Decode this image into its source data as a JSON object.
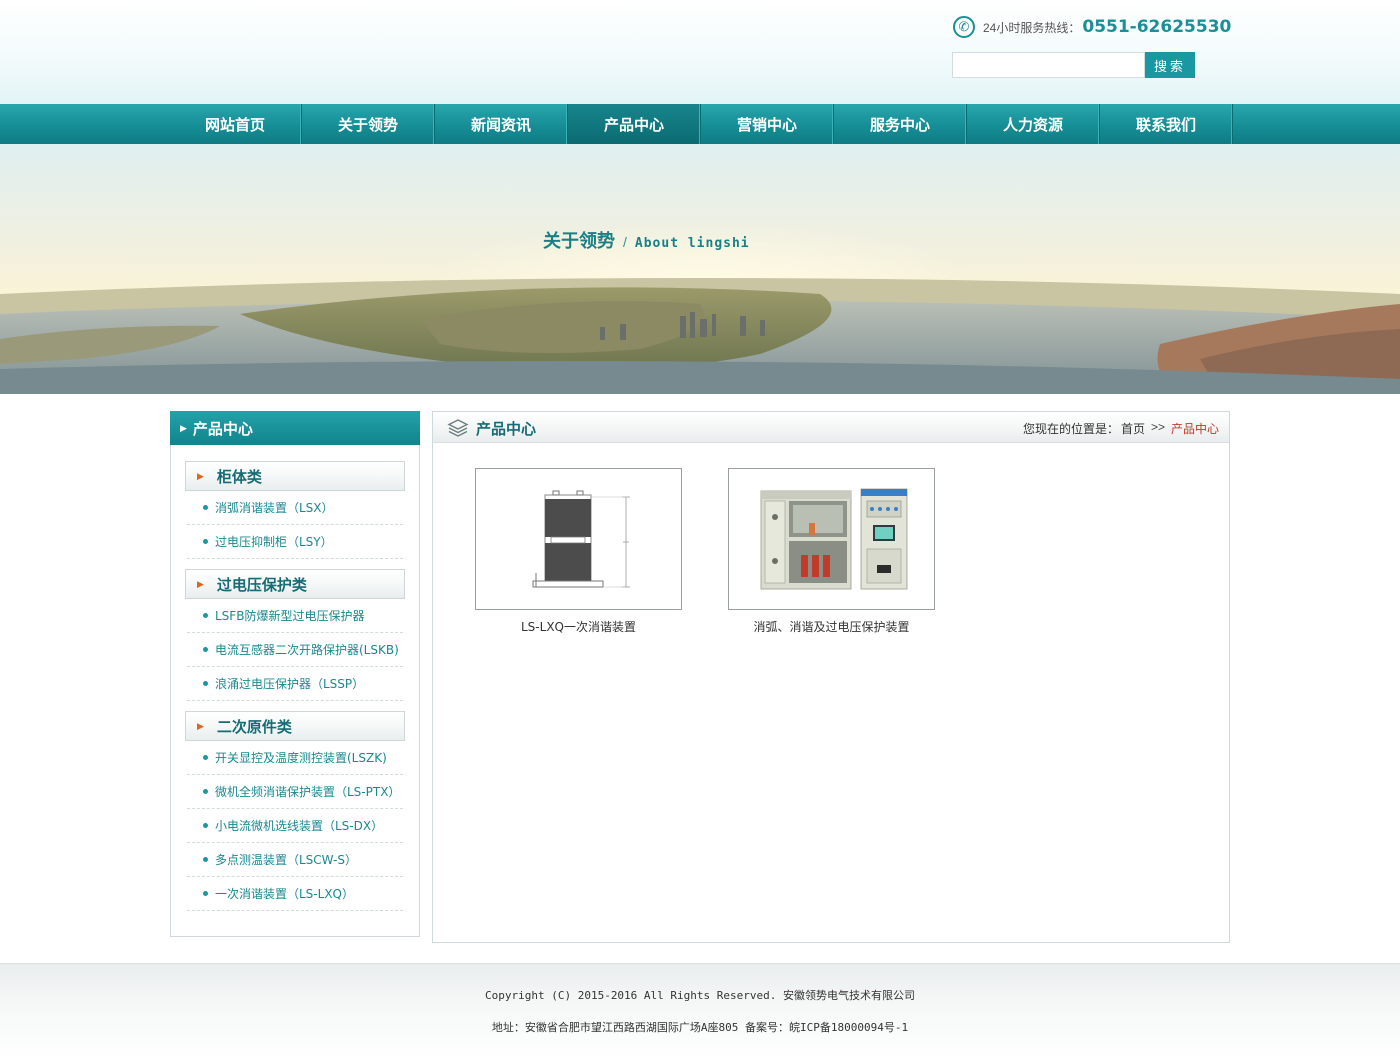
{
  "header": {
    "hotline_label": "24小时服务热线：",
    "hotline_number": "0551-62625530",
    "search_placeholder": "",
    "search_button": "搜索"
  },
  "nav": {
    "items": [
      {
        "label": "网站首页"
      },
      {
        "label": "关于领势"
      },
      {
        "label": "新闻资讯"
      },
      {
        "label": "产品中心",
        "active": true
      },
      {
        "label": "营销中心"
      },
      {
        "label": "服务中心"
      },
      {
        "label": "人力资源"
      },
      {
        "label": "联系我们"
      }
    ]
  },
  "banner": {
    "title_cn": "关于领势",
    "separator": "/",
    "title_en": "About lingshi"
  },
  "sidebar": {
    "title": "产品中心",
    "categories": [
      {
        "label": "柜体类",
        "items": [
          "消弧消谐装置（LSX）",
          "过电压抑制柜（LSY）"
        ]
      },
      {
        "label": "过电压保护类",
        "items": [
          "LSFB防爆新型过电压保护器",
          "电流互感器二次开路保护器(LSKB)",
          "浪涌过电压保护器（LSSP）"
        ]
      },
      {
        "label": "二次原件类",
        "items": [
          "开关显控及温度测控装置(LSZK)",
          "微机全频消谐保护装置（LS-PTX）",
          "小电流微机选线装置（LS-DX）",
          "多点测温装置（LSCW-S）",
          "一次消谐装置（LS-LXQ）"
        ]
      }
    ]
  },
  "main": {
    "title": "产品中心",
    "breadcrumb": {
      "prefix": "您现在的位置是：",
      "home": "首页",
      "separator": ">>",
      "current": "产品中心"
    },
    "products": [
      {
        "name": "LS-LXQ一次消谐装置"
      },
      {
        "name": "消弧、消谐及过电压保护装置"
      }
    ]
  },
  "footer": {
    "copyright": "Copyright (C) 2015-2016 All Rights Reserved. 安徽领势电气技术有限公司",
    "address": "地址：安徽省合肥市望江西路西湖国际广场A座805   备案号：皖ICP备18000094号-1"
  },
  "colors": {
    "brand_teal": "#1a98a1",
    "nav_dark": "#0f7c84",
    "breadcrumb_current": "#c0392b",
    "bullet_orange": "#e2631c"
  }
}
